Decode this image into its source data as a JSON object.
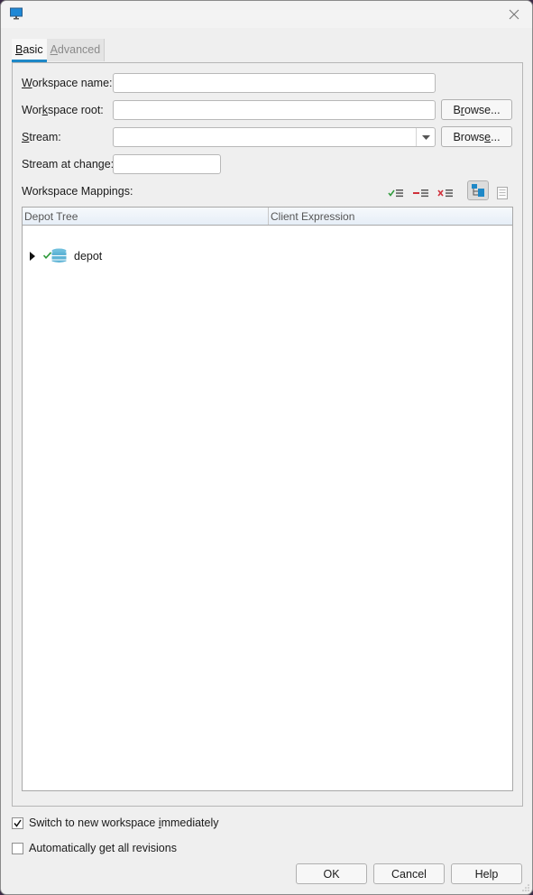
{
  "window": {
    "title": "",
    "icon": "monitor-icon",
    "close_icon": "close-icon"
  },
  "tabs": [
    {
      "label_prefix": "",
      "mnemonic": "B",
      "label_rest": "asic",
      "active": true
    },
    {
      "label_prefix": "",
      "mnemonic": "A",
      "label_rest": "dvanced",
      "active": false
    }
  ],
  "form": {
    "workspace_name": {
      "label_prefix": "",
      "mnemonic": "W",
      "label_rest": "orkspace name:",
      "value": ""
    },
    "workspace_root": {
      "label_prefix": "Wor",
      "mnemonic": "k",
      "label_rest": "space root:",
      "value": "",
      "browse_prefix": "B",
      "browse_mnemonic": "r",
      "browse_rest": "owse..."
    },
    "stream": {
      "label_prefix": "",
      "mnemonic": "S",
      "label_rest": "tream:",
      "value": "",
      "browse_prefix": "Brows",
      "browse_mnemonic": "e",
      "browse_rest": "..."
    },
    "stream_at_change": {
      "label_prefix": "Stream at chan",
      "mnemonic": "g",
      "label_rest": "e:",
      "value": ""
    },
    "mappings_label": "Workspace Mappings:"
  },
  "mapping_tools": [
    {
      "name": "include-mapping-icon",
      "color": "#2e9a3a"
    },
    {
      "name": "exclude-mapping-icon",
      "color": "#d0303a"
    },
    {
      "name": "remove-mapping-icon",
      "color": "#d0303a"
    },
    {
      "name": "tree-view-icon",
      "pressed": true
    },
    {
      "name": "text-view-icon",
      "pressed": false
    }
  ],
  "tree": {
    "columns": [
      "Depot Tree",
      "Client Expression"
    ],
    "rows": [
      {
        "label": "depot",
        "expanded": false,
        "mapped": true,
        "icon": "depot-icon"
      }
    ]
  },
  "options": {
    "switch": {
      "label_prefix": "Switch to new workspace ",
      "mnemonic": "i",
      "label_rest": "mmediately",
      "checked": true
    },
    "auto_get": {
      "label_prefix": "Automatically ",
      "mnemonic": "g",
      "label_rest": "et all revisions",
      "checked": false
    }
  },
  "buttons": {
    "ok": "OK",
    "cancel": "Cancel",
    "help": "Help"
  },
  "colors": {
    "accent": "#1e88c7",
    "check_green": "#2e9a3a",
    "depot_blue": "#5fb4d6"
  }
}
